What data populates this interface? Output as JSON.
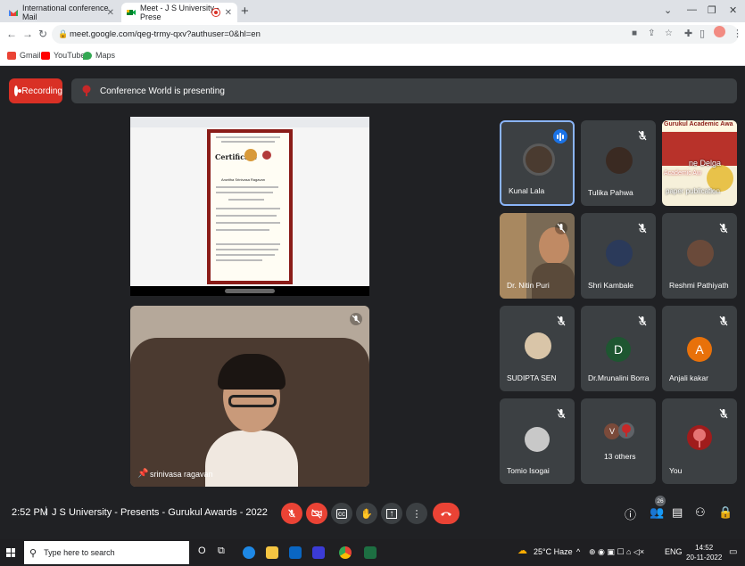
{
  "browser": {
    "tabs": [
      {
        "title": "International conference Mail",
        "favicon": "gmail-icon"
      },
      {
        "title": "Meet - J S University - Prese",
        "favicon": "meet-icon",
        "recording": true
      }
    ],
    "address": "meet.google.com/qeg-trmy-qxv?authuser=0&hl=en",
    "bookmarks": [
      {
        "label": "Gmail",
        "color": "#ea4335"
      },
      {
        "label": "YouTube",
        "color": "#ff0000"
      },
      {
        "label": "Maps",
        "color": "#34a853"
      }
    ]
  },
  "meet": {
    "recording_label": "Recording",
    "presenting_text": "Conference World is presenting",
    "self_name": "srinivasa ragavan",
    "tiles": [
      {
        "name": "Kunal Lala",
        "kind": "photo",
        "avatar_color": "#4a3b30",
        "speaking": true,
        "muted": false
      },
      {
        "name": "Tulika Pahwa",
        "kind": "photo",
        "avatar_color": "#3a2a22",
        "muted": true
      },
      {
        "name": "",
        "kind": "banner",
        "banner_lines": [
          "Gurukul Academic Awa",
          "Academic Aw",
          "ne Delga",
          "paper publication"
        ],
        "muted": false
      },
      {
        "name": "Dr. Nitin Puri",
        "kind": "video",
        "muted": true
      },
      {
        "name": "Shri Kambale",
        "kind": "photo",
        "avatar_color": "#2b3a5a",
        "muted": true
      },
      {
        "name": "Reshmi Pathiyath",
        "kind": "photo",
        "avatar_color": "#6a4a3a",
        "muted": true
      },
      {
        "name": "SUDIPTA SEN",
        "kind": "photo",
        "avatar_color": "#d9c5a8",
        "muted": true
      },
      {
        "name": "Dr.Mrunalini Borra",
        "kind": "letter",
        "letter": "D",
        "avatar_color": "#1e5631",
        "muted": true
      },
      {
        "name": "Anjali kakar",
        "kind": "letter",
        "letter": "A",
        "avatar_color": "#e8710a",
        "muted": true
      },
      {
        "name": "Tomio Isogai",
        "kind": "photo",
        "avatar_color": "#c8c8c8",
        "muted": true
      },
      {
        "name": "13 others",
        "kind": "others",
        "letter": "V",
        "avatar_color": "#7a4a3a",
        "muted": false
      },
      {
        "name": "You",
        "kind": "logo",
        "avatar_color": "#a01c1c",
        "muted": true
      }
    ],
    "time": "2:52 PM",
    "meeting_title": "J S University - Presents - Gurukul Awards - 2022",
    "participants_count": "26",
    "certificate": {
      "heading": "Certificate",
      "name": "Anwitha Srinivasa Ragavan"
    }
  },
  "taskbar": {
    "search_placeholder": "Type here to search",
    "weather": "25°C  Haze",
    "language": "ENG",
    "time": "14:52",
    "date": "20-11-2022"
  }
}
